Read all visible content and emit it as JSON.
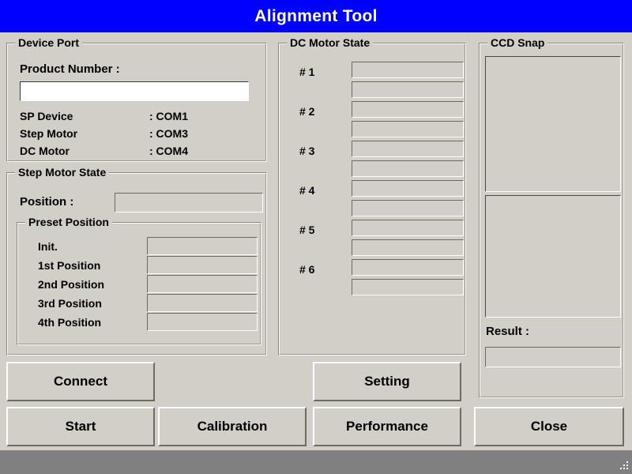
{
  "window": {
    "title": "Alignment Tool"
  },
  "device_port": {
    "title": "Device Port",
    "product_number_label": "Product Number :",
    "product_number_value": "",
    "product_number_placeholder": "",
    "rows": [
      {
        "label": "SP Device",
        "value": ": COM1"
      },
      {
        "label": "Step Motor",
        "value": ": COM3"
      },
      {
        "label": "DC Motor",
        "value": ": COM4"
      }
    ]
  },
  "step_motor_state": {
    "title": "Step Motor State",
    "position_label": "Position :",
    "position_value": "",
    "preset": {
      "title": "Preset Position",
      "rows": [
        {
          "label": "Init.",
          "value": ""
        },
        {
          "label": "1st Position",
          "value": ""
        },
        {
          "label": "2nd Position",
          "value": ""
        },
        {
          "label": "3rd Position",
          "value": ""
        },
        {
          "label": "4th Position",
          "value": ""
        }
      ]
    }
  },
  "dc_motor_state": {
    "title": "DC Motor State",
    "motors": [
      {
        "label": "# 1",
        "value_a": "",
        "value_b": ""
      },
      {
        "label": "# 2",
        "value_a": "",
        "value_b": ""
      },
      {
        "label": "# 3",
        "value_a": "",
        "value_b": ""
      },
      {
        "label": "# 4",
        "value_a": "",
        "value_b": ""
      },
      {
        "label": "# 5",
        "value_a": "",
        "value_b": ""
      },
      {
        "label": "# 6",
        "value_a": "",
        "value_b": ""
      }
    ]
  },
  "ccd_snap": {
    "title": "CCD Snap",
    "preview_top": "",
    "preview_bottom": "",
    "result_label": "Result :",
    "result_value": "",
    "result_secondary": ""
  },
  "buttons": {
    "connect": "Connect",
    "setting": "Setting",
    "start": "Start",
    "calibration": "Calibration",
    "performance": "Performance",
    "close": "Close"
  },
  "statusbar": {
    "text": "",
    "grip_icon": "resize-grip-icon"
  },
  "colors": {
    "titlebar": "#0000ff",
    "titlebar_text": "#ffffff",
    "dialog_face": "#d2cfc8",
    "statusbar": "#808080",
    "text": "#000000"
  }
}
